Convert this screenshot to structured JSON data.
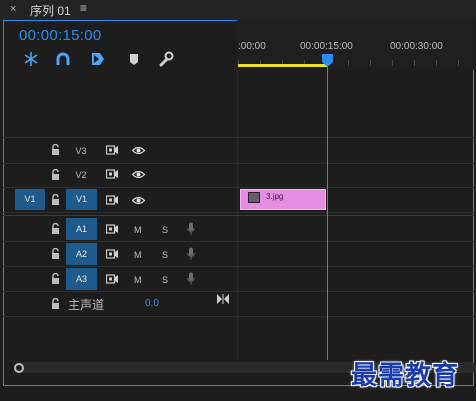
{
  "titlebar": {
    "close": "×",
    "title": "序列 01",
    "menu": "≡"
  },
  "timecode": "00:00:15:00",
  "tools": [
    "snap-icon",
    "linked-selection-icon",
    "add-marker-icon",
    "marker-icon",
    "wrench-icon"
  ],
  "ruler": {
    "labels": [
      ":00:00",
      "00:00:15:00",
      "00:00:30:00"
    ]
  },
  "tracks": {
    "video": [
      {
        "label": "V3",
        "source": ""
      },
      {
        "label": "V2",
        "source": ""
      },
      {
        "label": "V1",
        "source": "V1"
      }
    ],
    "audio": [
      {
        "label": "A1",
        "m": "M",
        "s": "S"
      },
      {
        "label": "A2",
        "m": "M",
        "s": "S"
      },
      {
        "label": "A3",
        "m": "M",
        "s": "S"
      }
    ],
    "master": {
      "label": "主声道",
      "value": "0.0"
    }
  },
  "clip": {
    "name": "3.jpg",
    "color": "#e58de1"
  },
  "accent": "#2d8ceb",
  "watermark": "最需教育"
}
